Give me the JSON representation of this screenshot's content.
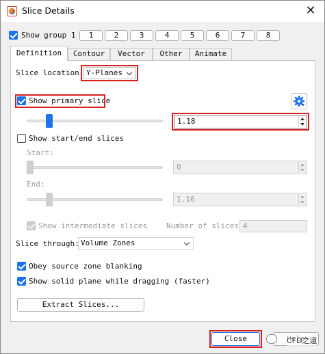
{
  "window": {
    "title": "Slice Details",
    "close_glyph": "✕"
  },
  "groups": {
    "show_group_label": "Show group 1",
    "show_group_checked": true,
    "buttons": [
      "1",
      "2",
      "3",
      "4",
      "5",
      "6",
      "7",
      "8"
    ]
  },
  "tabs": [
    {
      "label": "Definition",
      "active": true
    },
    {
      "label": "Contour",
      "active": false
    },
    {
      "label": "Vector",
      "active": false
    },
    {
      "label": "Other",
      "active": false
    },
    {
      "label": "Animate",
      "active": false
    }
  ],
  "definition": {
    "slice_location_label": "Slice location:",
    "slice_location_value": "Y-Planes",
    "show_primary_label": "Show primary slice",
    "show_primary_checked": true,
    "primary_value": "1.18",
    "primary_slider_fraction": 0.17,
    "show_start_end_label": "Show start/end slices",
    "show_start_end_checked": false,
    "start_label": "Start:",
    "start_value": "0",
    "start_slider_fraction": 0.0,
    "end_label": "End:",
    "end_value": "1.16",
    "end_slider_fraction": 0.17,
    "show_intermediate_label": "Show intermediate slices",
    "show_intermediate_checked": true,
    "num_slices_label": "Number of slices:",
    "num_slices_value": "4",
    "slice_through_label": "Slice through:",
    "slice_through_value": "Volume Zones",
    "obey_blanking_label": "Obey source zone blanking",
    "obey_blanking_checked": true,
    "show_solid_plane_label": "Show solid plane while dragging (faster)",
    "show_solid_plane_checked": true,
    "extract_button": "Extract Slices..."
  },
  "footer": {
    "close_button": "Close",
    "help_button": "Help",
    "watermark": "CFD之道"
  },
  "icons": {
    "app": "tecplot-app-icon",
    "gear": "gear-icon",
    "close": "close-icon"
  },
  "colors": {
    "accent": "#1a73e8",
    "highlight": "#d92020"
  }
}
